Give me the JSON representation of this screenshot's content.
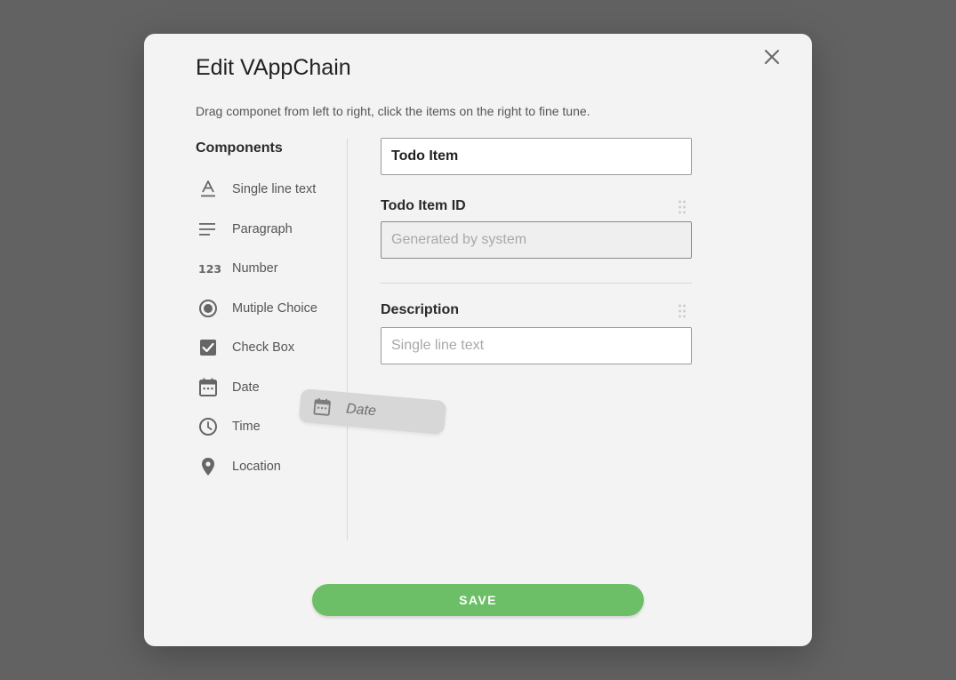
{
  "dialog": {
    "title": "Edit VAppChain",
    "subtitle": "Drag componet from left to right, click the items on the right to fine tune.",
    "close_icon": "close-icon"
  },
  "components": {
    "heading": "Components",
    "items": [
      {
        "label": "Single line text",
        "icon": "text-format-icon"
      },
      {
        "label": "Paragraph",
        "icon": "paragraph-icon"
      },
      {
        "label": "Number",
        "icon": "number-icon"
      },
      {
        "label": "Mutiple Choice",
        "icon": "radio-button-icon"
      },
      {
        "label": "Check Box",
        "icon": "checkbox-icon"
      },
      {
        "label": "Date",
        "icon": "calendar-icon"
      },
      {
        "label": "Time",
        "icon": "clock-icon"
      },
      {
        "label": "Location",
        "icon": "location-pin-icon"
      }
    ]
  },
  "form": {
    "title_value": "Todo Item",
    "fields": [
      {
        "label": "Todo Item ID",
        "placeholder": "Generated by system",
        "disabled": true
      },
      {
        "label": "Description",
        "placeholder": "Single line text",
        "disabled": false
      }
    ]
  },
  "drag_ghost": {
    "label": "Date",
    "icon": "calendar-icon"
  },
  "actions": {
    "save_label": "SAVE"
  },
  "colors": {
    "overlay": "#626262",
    "modal_bg": "#f3f3f3",
    "accent_green": "#6dbf67",
    "icon_gray": "#666666"
  }
}
